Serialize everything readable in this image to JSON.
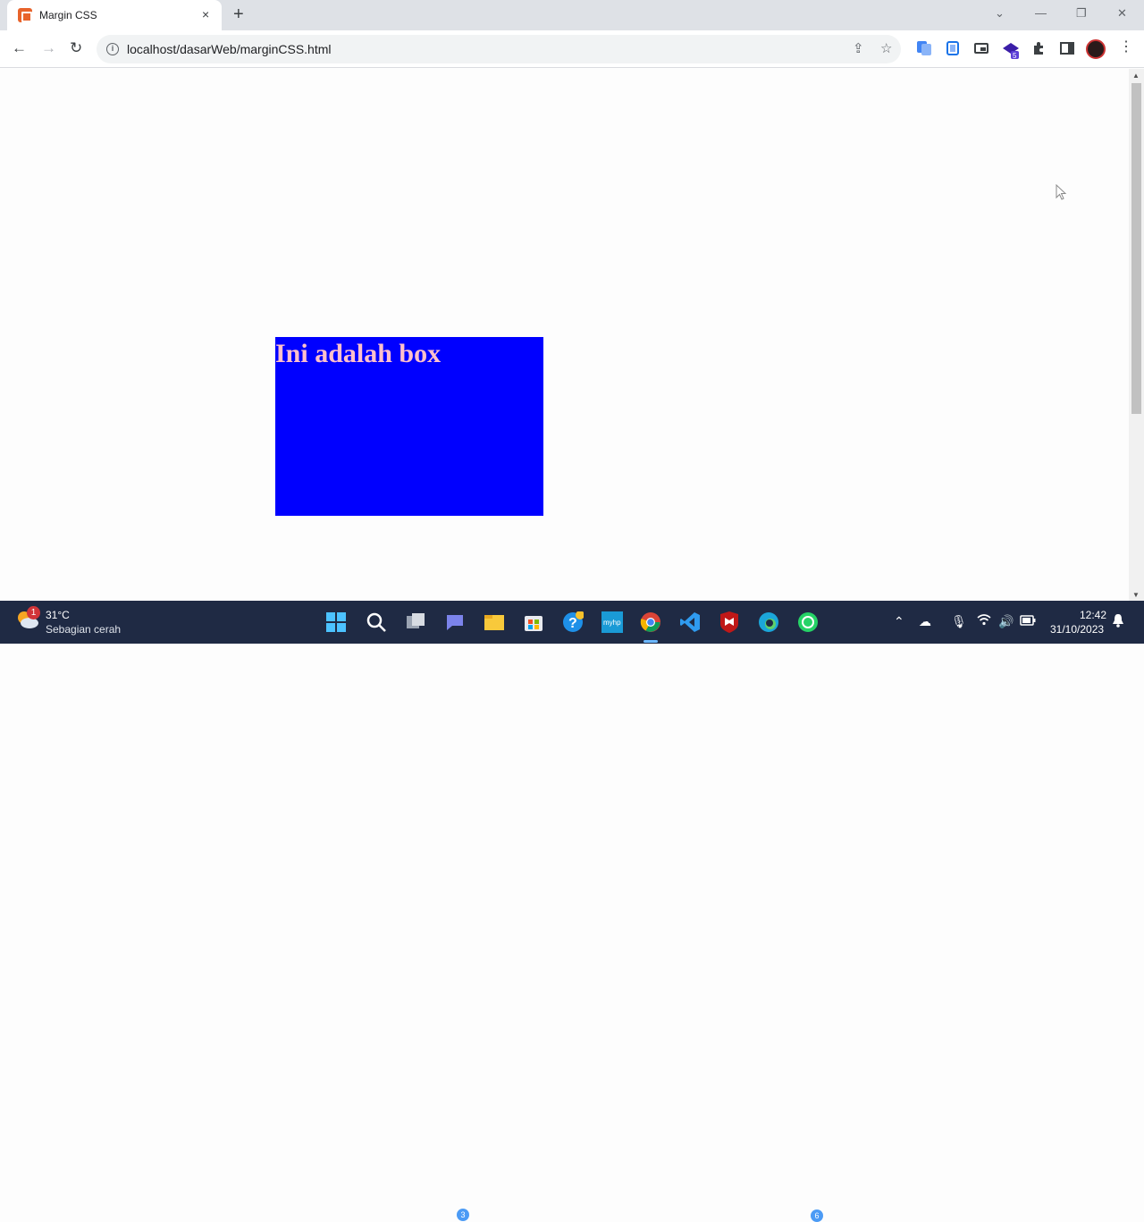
{
  "browser": {
    "tab_title": "Margin CSS",
    "tab_close": "×",
    "new_tab": "+",
    "window_controls": {
      "tabsearch": "⌄",
      "minimize": "—",
      "restore": "❐",
      "close": "✕"
    },
    "nav": {
      "back": "←",
      "forward": "→",
      "reload": "↻"
    },
    "url": "localhost/dasarWeb/marginCSS.html",
    "menu": "⋮"
  },
  "page": {
    "box_text": "Ini adalah box",
    "colors": {
      "box_background": "#0000ff",
      "box_text": "#ffc0cb"
    }
  },
  "taskbar": {
    "weather_badge": "1",
    "temperature": "31°C",
    "weather_desc": "Sebagian cerah",
    "badges": {
      "teams": "3",
      "whatsapp": "6"
    },
    "time": "12:42",
    "date": "31/10/2023"
  }
}
